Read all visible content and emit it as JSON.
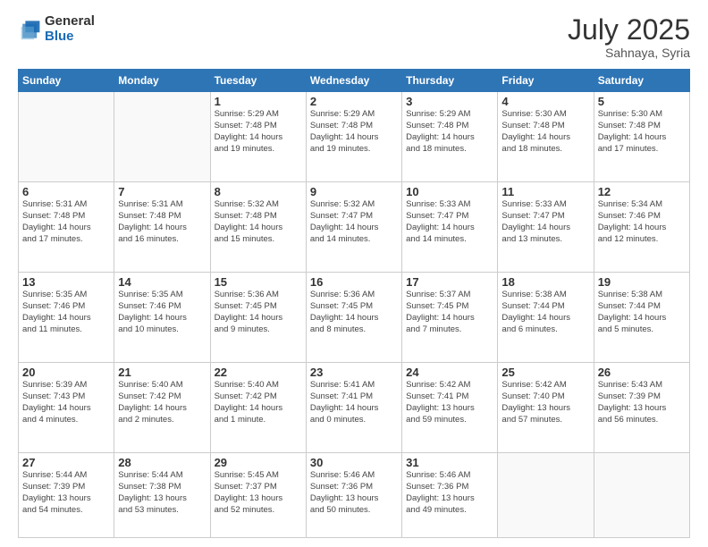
{
  "logo": {
    "general": "General",
    "blue": "Blue"
  },
  "title": "July 2025",
  "subtitle": "Sahnaya, Syria",
  "days_header": [
    "Sunday",
    "Monday",
    "Tuesday",
    "Wednesday",
    "Thursday",
    "Friday",
    "Saturday"
  ],
  "weeks": [
    [
      {
        "day": "",
        "info": ""
      },
      {
        "day": "",
        "info": ""
      },
      {
        "day": "1",
        "info": "Sunrise: 5:29 AM\nSunset: 7:48 PM\nDaylight: 14 hours\nand 19 minutes."
      },
      {
        "day": "2",
        "info": "Sunrise: 5:29 AM\nSunset: 7:48 PM\nDaylight: 14 hours\nand 19 minutes."
      },
      {
        "day": "3",
        "info": "Sunrise: 5:29 AM\nSunset: 7:48 PM\nDaylight: 14 hours\nand 18 minutes."
      },
      {
        "day": "4",
        "info": "Sunrise: 5:30 AM\nSunset: 7:48 PM\nDaylight: 14 hours\nand 18 minutes."
      },
      {
        "day": "5",
        "info": "Sunrise: 5:30 AM\nSunset: 7:48 PM\nDaylight: 14 hours\nand 17 minutes."
      }
    ],
    [
      {
        "day": "6",
        "info": "Sunrise: 5:31 AM\nSunset: 7:48 PM\nDaylight: 14 hours\nand 17 minutes."
      },
      {
        "day": "7",
        "info": "Sunrise: 5:31 AM\nSunset: 7:48 PM\nDaylight: 14 hours\nand 16 minutes."
      },
      {
        "day": "8",
        "info": "Sunrise: 5:32 AM\nSunset: 7:48 PM\nDaylight: 14 hours\nand 15 minutes."
      },
      {
        "day": "9",
        "info": "Sunrise: 5:32 AM\nSunset: 7:47 PM\nDaylight: 14 hours\nand 14 minutes."
      },
      {
        "day": "10",
        "info": "Sunrise: 5:33 AM\nSunset: 7:47 PM\nDaylight: 14 hours\nand 14 minutes."
      },
      {
        "day": "11",
        "info": "Sunrise: 5:33 AM\nSunset: 7:47 PM\nDaylight: 14 hours\nand 13 minutes."
      },
      {
        "day": "12",
        "info": "Sunrise: 5:34 AM\nSunset: 7:46 PM\nDaylight: 14 hours\nand 12 minutes."
      }
    ],
    [
      {
        "day": "13",
        "info": "Sunrise: 5:35 AM\nSunset: 7:46 PM\nDaylight: 14 hours\nand 11 minutes."
      },
      {
        "day": "14",
        "info": "Sunrise: 5:35 AM\nSunset: 7:46 PM\nDaylight: 14 hours\nand 10 minutes."
      },
      {
        "day": "15",
        "info": "Sunrise: 5:36 AM\nSunset: 7:45 PM\nDaylight: 14 hours\nand 9 minutes."
      },
      {
        "day": "16",
        "info": "Sunrise: 5:36 AM\nSunset: 7:45 PM\nDaylight: 14 hours\nand 8 minutes."
      },
      {
        "day": "17",
        "info": "Sunrise: 5:37 AM\nSunset: 7:45 PM\nDaylight: 14 hours\nand 7 minutes."
      },
      {
        "day": "18",
        "info": "Sunrise: 5:38 AM\nSunset: 7:44 PM\nDaylight: 14 hours\nand 6 minutes."
      },
      {
        "day": "19",
        "info": "Sunrise: 5:38 AM\nSunset: 7:44 PM\nDaylight: 14 hours\nand 5 minutes."
      }
    ],
    [
      {
        "day": "20",
        "info": "Sunrise: 5:39 AM\nSunset: 7:43 PM\nDaylight: 14 hours\nand 4 minutes."
      },
      {
        "day": "21",
        "info": "Sunrise: 5:40 AM\nSunset: 7:42 PM\nDaylight: 14 hours\nand 2 minutes."
      },
      {
        "day": "22",
        "info": "Sunrise: 5:40 AM\nSunset: 7:42 PM\nDaylight: 14 hours\nand 1 minute."
      },
      {
        "day": "23",
        "info": "Sunrise: 5:41 AM\nSunset: 7:41 PM\nDaylight: 14 hours\nand 0 minutes."
      },
      {
        "day": "24",
        "info": "Sunrise: 5:42 AM\nSunset: 7:41 PM\nDaylight: 13 hours\nand 59 minutes."
      },
      {
        "day": "25",
        "info": "Sunrise: 5:42 AM\nSunset: 7:40 PM\nDaylight: 13 hours\nand 57 minutes."
      },
      {
        "day": "26",
        "info": "Sunrise: 5:43 AM\nSunset: 7:39 PM\nDaylight: 13 hours\nand 56 minutes."
      }
    ],
    [
      {
        "day": "27",
        "info": "Sunrise: 5:44 AM\nSunset: 7:39 PM\nDaylight: 13 hours\nand 54 minutes."
      },
      {
        "day": "28",
        "info": "Sunrise: 5:44 AM\nSunset: 7:38 PM\nDaylight: 13 hours\nand 53 minutes."
      },
      {
        "day": "29",
        "info": "Sunrise: 5:45 AM\nSunset: 7:37 PM\nDaylight: 13 hours\nand 52 minutes."
      },
      {
        "day": "30",
        "info": "Sunrise: 5:46 AM\nSunset: 7:36 PM\nDaylight: 13 hours\nand 50 minutes."
      },
      {
        "day": "31",
        "info": "Sunrise: 5:46 AM\nSunset: 7:36 PM\nDaylight: 13 hours\nand 49 minutes."
      },
      {
        "day": "",
        "info": ""
      },
      {
        "day": "",
        "info": ""
      }
    ]
  ]
}
